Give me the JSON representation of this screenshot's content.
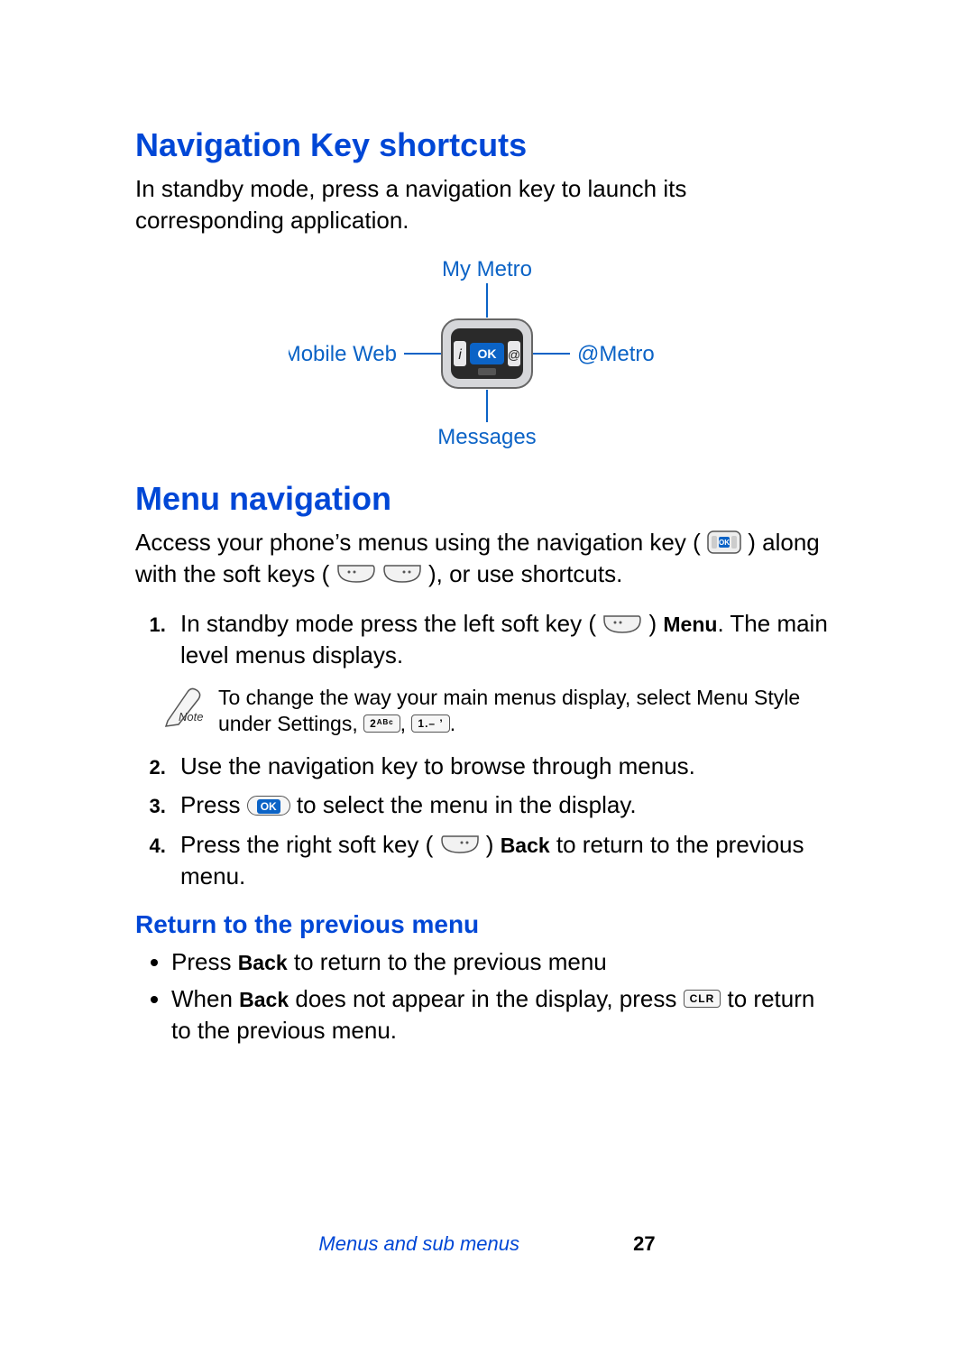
{
  "h_nav": "Navigation Key shortcuts",
  "p_nav": "In standby mode, press a navigation key to launch its corresponding application.",
  "diag": {
    "up": "My Metro",
    "left": "Mobile Web",
    "right": "@Metro",
    "down": "Messages",
    "ok": "OK"
  },
  "h_menu": "Menu navigation",
  "p_menu_1a": "Access your phone’s menus using the navigation key (",
  "p_menu_1b": ") along with the soft keys (",
  "p_menu_1c": "), or use shortcuts.",
  "step1a": "In standby mode press the left soft key (",
  "step1b": ") ",
  "step1_menu": "Menu",
  "step1c": ". The main level menus displays.",
  "note_a": "To change the way your main menus display, select Menu Style under Settings, ",
  "note_b": ", ",
  "note_c": ".",
  "note_key2": "2ᴬᴮᶜ",
  "note_key1": "1.– ʼ",
  "step2": "Use the navigation key to browse through menus.",
  "step3a": "Press ",
  "step3_ok": "OK",
  "step3b": " to select the menu in the display.",
  "step4a": "Press the right soft key (",
  "step4b": ") ",
  "step4_back": "Back",
  "step4c": " to return to the previous menu.",
  "h_return": "Return to the previous menu",
  "b1a": "Press ",
  "b1_back": "Back",
  "b1b": " to return to the previous menu",
  "b2a": "When ",
  "b2_back": "Back",
  "b2b": " does not appear in the display, press ",
  "b2_clr": "CLR",
  "b2c": " to return to the previous menu.",
  "footer_title": "Menus and sub menus",
  "footer_page": "27"
}
